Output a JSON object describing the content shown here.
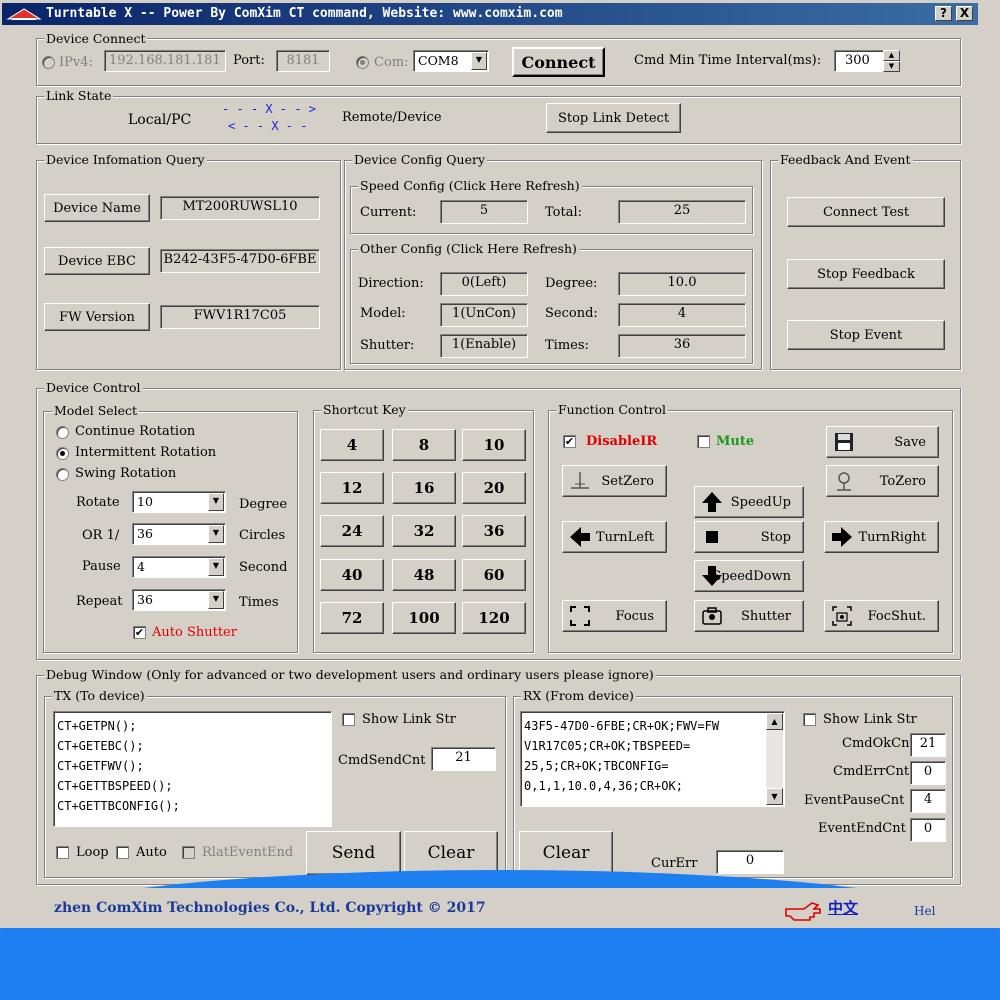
{
  "title": "Turntable X -- Power By ComXim CT command, Website: www.comxim.com",
  "titlebar": {
    "help": "?",
    "close": "X"
  },
  "device_connect": {
    "label": "Device Connect",
    "ipv4_label": "IPv4:",
    "ip_value": "192.168.181.181",
    "port_label": "Port:",
    "port_value": "8181",
    "com_label": "Com:",
    "com_value": "COM8",
    "connect_button": "Connect",
    "cmd_interval_label": "Cmd Min Time Interval(ms):",
    "cmd_interval_value": "300"
  },
  "link_state": {
    "label": "Link State",
    "local": "Local/PC",
    "remote": "Remote/Device",
    "arrow_right": "- - - X - - >",
    "arrow_left": "< - - X - -",
    "stop_button": "Stop Link Detect"
  },
  "device_info": {
    "label": "Device Infomation Query",
    "name_button": "Device Name",
    "name_value": "MT200RUWSL10",
    "ebc_button": "Device EBC",
    "ebc_value": "B242-43F5-47D0-6FBE",
    "fw_button": "FW Version",
    "fw_value": "FWV1R17C05"
  },
  "device_config": {
    "label": "Device Config  Query",
    "speed_label": "Speed Config (Click Here Refresh)",
    "current_label": "Current:",
    "current_value": "5",
    "total_label": "Total:",
    "total_value": "25",
    "other_label": "Other Config (Click Here Refresh)",
    "direction_label": "Direction:",
    "direction_value": "0(Left)",
    "degree_label": "Degree:",
    "degree_value": "10.0",
    "model_label": "Model:",
    "model_value": "1(UnCon)",
    "second_label": "Second:",
    "second_value": "4",
    "shutter_label": "Shutter:",
    "shutter_value": "1(Enable)",
    "times_label": "Times:",
    "times_value": "36"
  },
  "feedback": {
    "label": "Feedback And Event",
    "connect_test": "Connect Test",
    "stop_feedback": "Stop Feedback",
    "stop_event": "Stop Event"
  },
  "device_control": {
    "label": "Device Control",
    "model_select": {
      "label": "Model Select",
      "continue": "Continue Rotation",
      "intermittent": "Intermittent Rotation",
      "swing": "Swing Rotation",
      "rotate_label": "Rotate",
      "rotate_value": "10",
      "rotate_unit": "Degree",
      "or_label": "OR 1/",
      "or_value": "36",
      "or_unit": "Circles",
      "pause_label": "Pause",
      "pause_value": "4",
      "pause_unit": "Second",
      "repeat_label": "Repeat",
      "repeat_value": "36",
      "repeat_unit": "Times",
      "auto_shutter": "Auto Shutter"
    },
    "shortcut": {
      "label": "Shortcut Key",
      "keys": [
        "4",
        "8",
        "10",
        "12",
        "16",
        "20",
        "24",
        "32",
        "36",
        "40",
        "48",
        "60",
        "72",
        "100",
        "120"
      ]
    },
    "function": {
      "label": "Function Control",
      "disable_ir": "DisableIR",
      "mute": "Mute",
      "save": "Save",
      "set_zero": "SetZero",
      "to_zero": "ToZero",
      "speed_up": "SpeedUp",
      "turn_left": "TurnLeft",
      "stop": "Stop",
      "turn_right": "TurnRight",
      "speed_down": "SpeedDown",
      "focus": "Focus",
      "shutter": "Shutter",
      "focshut": "FocShut."
    }
  },
  "debug": {
    "label": "Debug Window (Only for advanced or two development users and ordinary users please ignore)",
    "tx_label": "TX (To device)",
    "tx_text": "CT+GETPN();\nCT+GETEBC();\nCT+GETFWV();\nCT+GETTBSPEED();\nCT+GETTBCONFIG();",
    "tx_show_link": "Show Link Str",
    "cmd_send_cnt_label": "CmdSendCnt",
    "cmd_send_cnt_value": "21",
    "loop": "Loop",
    "auto": "Auto",
    "rlat": "RlatEventEnd",
    "send": "Send",
    "clear_tx": "Clear",
    "rx_label": "RX (From device)",
    "rx_text": "43F5-47D0-6FBE;CR+OK;FWV=FW\nV1R17C05;CR+OK;TBSPEED=\n25,5;CR+OK;TBCONFIG=\n0,1,1,10.0,4,36;CR+OK;",
    "rx_show_link": "Show Link Str",
    "cmd_ok_label": "CmdOkCnt",
    "cmd_ok_value": "21",
    "cmd_err_label": "CmdErrCnt",
    "cmd_err_value": "0",
    "event_pause_label": "EventPauseCnt",
    "event_pause_value": "4",
    "event_end_label": "EventEndCnt",
    "event_end_value": "0",
    "clear_rx": "Clear",
    "cur_err_label": "CurErr",
    "cur_err_value": "0"
  },
  "footer": {
    "copyright": "zhen ComXim Technologies Co., Ltd. Copyright © 2017",
    "lang": "中文",
    "help": "Hel"
  },
  "colors": {
    "accent_red": "#e00000",
    "mute_green": "#1a9a1a",
    "band_blue": "#1e7ff0",
    "title_blue": "#0a246a"
  }
}
